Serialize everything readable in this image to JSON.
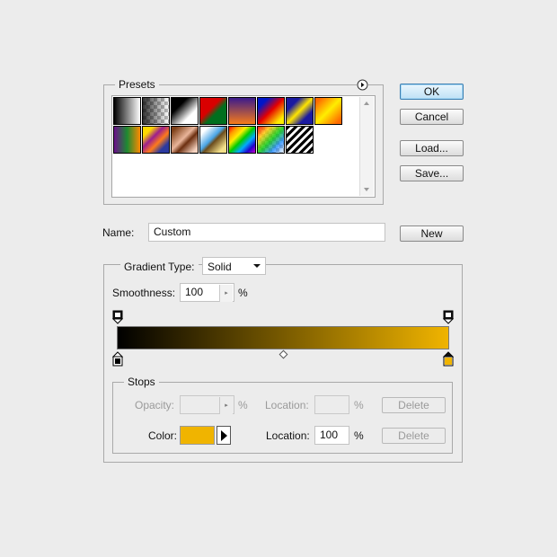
{
  "presets": {
    "legend": "Presets",
    "menu_icon": "circle-arrow-right-icon",
    "swatches": [
      {
        "name": "black-white",
        "css": "linear-gradient(90deg,#000,#fff)"
      },
      {
        "name": "black-transparent",
        "css": "linear-gradient(90deg,rgba(0,0,0,0.8),rgba(0,0,0,0))"
      },
      {
        "name": "foreground-background",
        "css": "linear-gradient(135deg,#000 30%,#fff 70%)"
      },
      {
        "name": "red-green",
        "css": "linear-gradient(135deg,#d90000 40%,#006f1e 60%)"
      },
      {
        "name": "violet-orange",
        "css": "linear-gradient(180deg,#3b1a8c,#f77c19)"
      },
      {
        "name": "blue-red-yellow",
        "css": "linear-gradient(135deg,#0016c8 20%,#e50000 50%,#ffee00 85%)"
      },
      {
        "name": "blue-yellow-blue",
        "css": "linear-gradient(135deg,#1a1aa0 25%,#ffe500 50%,#1a1aa0 75%)"
      },
      {
        "name": "orange-yellow-orange",
        "css": "linear-gradient(135deg,#ff6a00 10%,#ffee00 50%,#ff6a00 90%)"
      },
      {
        "name": "violet-green-orange",
        "css": "linear-gradient(90deg,#6a0e8a,#1d8a31 50%,#ff8a00)"
      },
      {
        "name": "yellow-violet-orange-blue",
        "css": "linear-gradient(135deg,#ffd800 20%,#9c1f8e 40%,#ff7a1a 60%,#2c3aa0 80%)"
      },
      {
        "name": "copper",
        "css": "linear-gradient(135deg,#7d3f17 10%,#e9b59a 45%,#6c2f10 60%,#f6d3c0 90%)"
      },
      {
        "name": "chrome",
        "css": "linear-gradient(135deg,#ffffff 15%,#4aa5e6 45%,#6b4c1c 55%,#f3e08a 85%)"
      },
      {
        "name": "spectrum",
        "css": "linear-gradient(135deg,#ff0000,#ff9900,#ffee00,#00cc00,#00aaff,#2200cc,#cc00cc)"
      },
      {
        "name": "transparent-rainbow",
        "css": "linear-gradient(135deg,rgba(255,0,0,0.9),rgba(255,200,0,0.8),rgba(0,200,0,0.8),rgba(0,120,255,0.7),rgba(255,255,255,0))"
      },
      {
        "name": "transparent-stripes",
        "css": "repeating-linear-gradient(135deg,#000 0 3px,#fff 3px 6px)"
      }
    ]
  },
  "buttons": {
    "ok": "OK",
    "cancel": "Cancel",
    "load": "Load...",
    "save": "Save...",
    "new": "New"
  },
  "name_field": {
    "label": "Name:",
    "value": "Custom"
  },
  "gradient": {
    "type_label": "Gradient Type:",
    "type_value": "Solid",
    "smoothness_label": "Smoothness:",
    "smoothness_value": "100",
    "smoothness_unit": "%",
    "start_color": "#000000",
    "end_color": "#f0b400"
  },
  "stops": {
    "legend": "Stops",
    "opacity_label": "Opacity:",
    "opacity_value": "",
    "opacity_unit": "%",
    "opacity_location_label": "Location:",
    "opacity_location_value": "",
    "opacity_location_unit": "%",
    "opacity_delete": "Delete",
    "color_label": "Color:",
    "color_value": "#f0b400",
    "color_location_label": "Location:",
    "color_location_value": "100",
    "color_location_unit": "%",
    "color_delete": "Delete"
  }
}
